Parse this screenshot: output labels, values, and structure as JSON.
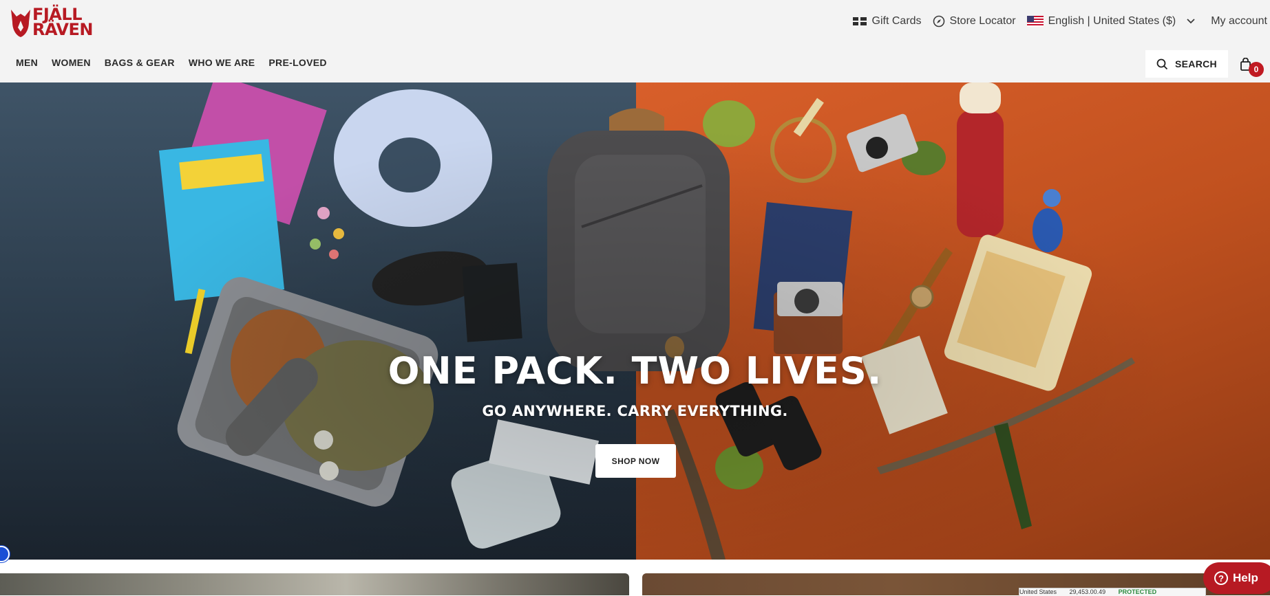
{
  "brand": {
    "logo_line1": "FJÄLL",
    "logo_line2": "RÄVEN",
    "color": "#b71a23"
  },
  "topbar": {
    "gift_cards": "Gift Cards",
    "store_locator": "Store Locator",
    "language": "English | United States ($)",
    "my_account": "My account"
  },
  "nav": {
    "items": [
      {
        "label": "MEN"
      },
      {
        "label": "WOMEN"
      },
      {
        "label": "BAGS & GEAR"
      },
      {
        "label": "WHO WE ARE"
      },
      {
        "label": "PRE-LOVED"
      }
    ],
    "search_label": "SEARCH",
    "cart_count": "0"
  },
  "hero": {
    "headline": "ONE PACK. TWO LIVES.",
    "subheadline": "GO ANYWHERE. CARRY EVERYTHING.",
    "cta": "SHOP NOW",
    "left_bg": "#3f5467",
    "right_bg": "#d85f2a"
  },
  "help": {
    "label": "Help"
  },
  "trust_bar": {
    "country": "United States",
    "price": "29,453.00.49",
    "status": "PROTECTED"
  }
}
